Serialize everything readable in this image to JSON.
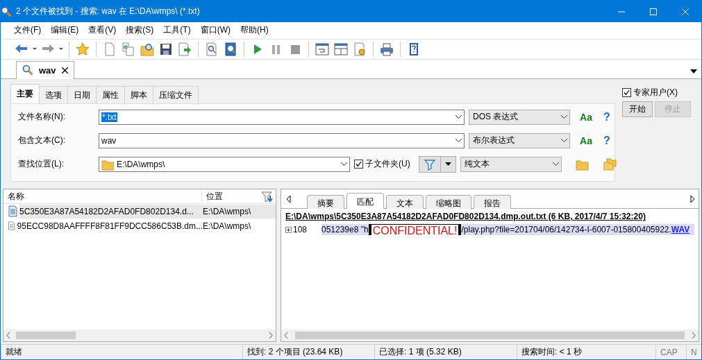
{
  "window": {
    "title": "2 个文件被找到 - 搜索: wav 在 E:\\DA\\wmps\\ (*.txt)"
  },
  "menu": [
    "文件(F)",
    "编辑(E)",
    "查看(V)",
    "搜索(S)",
    "工具(T)",
    "窗口(W)",
    "帮助(H)"
  ],
  "document_tabs": [
    {
      "label": "wav",
      "selected": true
    }
  ],
  "search": {
    "tabs": [
      {
        "label": "主要",
        "selected": true
      },
      {
        "label": "选项",
        "selected": false
      },
      {
        "label": "日期",
        "selected": false
      },
      {
        "label": "属性",
        "selected": false
      },
      {
        "label": "脚本",
        "selected": false
      },
      {
        "label": "压缩文件",
        "selected": false
      }
    ],
    "fields": [
      {
        "label": "文件名称(N):",
        "value": "*.txt",
        "highlighted": true,
        "mode": "DOS 表达式",
        "case_button": "Aa",
        "help_button": "?"
      },
      {
        "label": "包含文本(C):",
        "value": "wav",
        "highlighted": false,
        "mode": "布尔表达式",
        "case_button": "Aa",
        "help_button": "?"
      }
    ],
    "location": {
      "label": "查找位置(L):",
      "value": "E:\\DA\\wmps\\",
      "subfolders": {
        "label": "子文件夹(U)",
        "checked": true
      },
      "mode": "纯文本"
    },
    "expert": {
      "label": "专家用户(X)",
      "checked": true
    },
    "buttons": [
      {
        "label": "开始",
        "disabled": false
      },
      {
        "label": "停止",
        "disabled": true
      }
    ]
  },
  "results": {
    "columns": [
      "名称",
      "位置"
    ],
    "rows": [
      {
        "name": "5C350E3A87A54182D2AFAD0FD802D134.d...",
        "location": "E:\\DA\\wmps\\",
        "selected": true
      },
      {
        "name": "95ECC98D8AAFFFF8F81FF9DCC586C53B.dm...",
        "location": "E:\\DA\\wmps\\",
        "selected": false
      }
    ]
  },
  "preview": {
    "tabs": [
      {
        "label": "摘要",
        "selected": false
      },
      {
        "label": "匹配",
        "selected": true
      },
      {
        "label": "文本",
        "selected": false
      },
      {
        "label": "缩略图",
        "selected": false
      },
      {
        "label": "报告",
        "selected": false
      }
    ],
    "file_header": "E:\\DA\\wmps\\5C350E3A87A54182D2AFAD0FD802D134.dmp.out.txt   (6 KB,  2017/4/7 15:32:20)",
    "matches": [
      {
        "line": "108",
        "text_before": "051239e8  \"h",
        "redaction": "CONFIDENTIAL!",
        "text_after": "/play.php?file=201704/06/142734-I-6007-015800405922.",
        "link": "WAV"
      }
    ]
  },
  "status_bar": [
    "就绪",
    "找到: 2 个项目 (23.64 KB)",
    "已选择: 1 项 (5.32 KB)",
    "搜索时间: < 1 秒",
    "CAP",
    "N"
  ]
}
